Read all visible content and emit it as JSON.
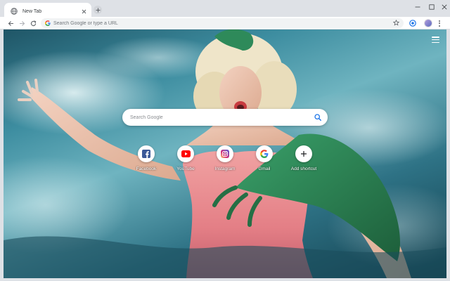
{
  "browser": {
    "tab": {
      "title": "New Tab",
      "favicon": "globe-icon"
    },
    "omnibox": {
      "placeholder": "Search Google or type a URL"
    }
  },
  "newtab": {
    "search": {
      "placeholder": "Search Google"
    },
    "shortcuts": [
      {
        "label": "Facebook",
        "icon": "facebook-icon",
        "color": "#3b5998"
      },
      {
        "label": "YouTube",
        "icon": "youtube-icon",
        "color": "#ff0000"
      },
      {
        "label": "Instagram",
        "icon": "instagram-icon",
        "color": "#c13584"
      },
      {
        "label": "Gmail",
        "icon": "google-icon",
        "color": "#4285f4"
      },
      {
        "label": "Add shortcut",
        "icon": "plus-icon",
        "color": "#202124"
      }
    ]
  },
  "colors": {
    "tabstrip": "#dee1e6",
    "toolbar": "#ffffff",
    "water": "#3d8da0",
    "dress": "#e88a8e",
    "creature": "#2f8a55"
  }
}
